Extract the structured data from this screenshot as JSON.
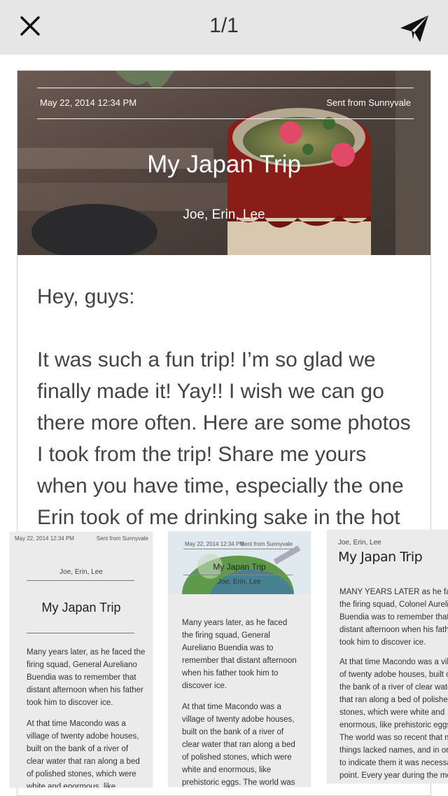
{
  "header": {
    "page_counter": "1/1",
    "close_icon": "close-icon",
    "send_icon": "paper-plane-icon"
  },
  "card": {
    "date": "May 22, 2014 12:34 PM",
    "sent_from": "Sent from Sunnyvale",
    "title": "My Japan Trip",
    "people": "Joe, Erin, Lee",
    "greeting": "Hey, guys:",
    "body_lines": [
      "It was such a fun trip! I’m so glad we",
      "finally made it! Yay!! I wish we can go",
      "there more often. Here are some photos",
      "I took from the trip! Share me yours",
      "when you have time, especially the one",
      "Erin took of me drinking sake in the hot"
    ]
  },
  "templates": [
    {
      "date": "May 22, 2014 12:34 PM",
      "sent_from": "Sent from Sunnyvale",
      "people": "Joe, Erin, Lee",
      "title": "My Japan Trip",
      "para1": "Many years later, as he faced the firing squad, General Aureliano Buendia was to remember that distant afternoon when his father took him to discover ice.",
      "para2": "At that time Macondo was a village of twenty adobe houses, built on the bank of a river of clear water that ran along a bed of polished stones, which were white and enormous, like prehistoric eggs."
    },
    {
      "date": "May 22, 2014 12:34 PM",
      "sent_from": "Sent from Sunnyvale",
      "title": "My Japan Trip",
      "people": "Joe, Erin, Lee",
      "para1": "Many years later, as he faced the firing squad, General Aureliano Buendia was to remember that distant afternoon when his father took him to discover ice.",
      "para2": "At that time Macondo was a village of twenty adobe houses, built on the bank of a river of clear water that ran along a bed of polished stones, which were white and enormous, like prehistoric eggs. The world was so recent that many things lacked names, and in order"
    },
    {
      "people": "Joe, Erin, Lee",
      "title": "My Japan Trip",
      "para1_lines": [
        "MANY YEARS LATER as he faced",
        "the firing squad, Colonel Aureliano",
        "Buendia was to remember that",
        "distant afternoon when his father",
        "took him to discover ice."
      ],
      "para2_lines": [
        "At that time Macondo was a village",
        "of twenty adobe houses, built on",
        "the bank of a river of clear water",
        "that ran along a bed of polished",
        "stones, which were white and",
        "enormous, like prehistoric eggs.",
        "The world was so recent that many",
        "things lacked names, and in order",
        "to indicate them it was necessary",
        "point. Every year during the month"
      ]
    }
  ]
}
